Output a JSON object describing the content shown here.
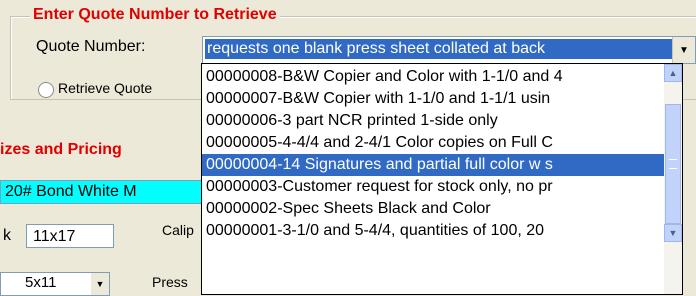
{
  "groupbox": {
    "title": "Enter Quote Number to Retrieve"
  },
  "quote": {
    "label": "Quote Number:",
    "selected_value": "requests one blank press sheet collated at back"
  },
  "retrieve_radio": {
    "label": "Retrieve Quote"
  },
  "section": {
    "title": "izes and Pricing"
  },
  "stock": {
    "value": "20# Bond White M"
  },
  "size": {
    "label": "k",
    "value": "11x17"
  },
  "caliper": {
    "label": "Calip"
  },
  "press_size": {
    "value": "5x11"
  },
  "press": {
    "label": "Press"
  },
  "dropdown": {
    "items": [
      "00000008-B&W Copier and Color with 1-1/0 and 4",
      "00000007-B&W Copier with 1-1/0 and 1-1/1 usin",
      "00000006-3 part NCR printed 1-side only",
      "00000005-4-4/4 and 2-4/1 Color copies on Full C",
      "00000004-14 Signatures and partial full color w s",
      "00000003-Customer request for stock only, no pr",
      "00000002-Spec Sheets Black and Color",
      "00000001-3-1/0 and 5-4/4, quantities of 100, 20"
    ],
    "selected_index": 4
  },
  "icons": {
    "combo_arrow": "chevron-down-icon",
    "scroll_up": "arrow-up-icon",
    "scroll_down": "arrow-down-icon"
  },
  "colors": {
    "accent": "#316ac5",
    "title_red": "#e00000",
    "stock_highlight": "#00ffff",
    "window_bg": "#ece9d8"
  }
}
